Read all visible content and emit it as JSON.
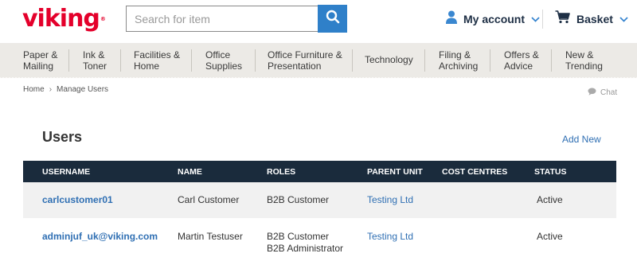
{
  "header": {
    "logo_text": "viking",
    "logo_tm": "®",
    "search_placeholder": "Search for item",
    "search_value": "",
    "account_label": "My account",
    "basket_label": "Basket",
    "brand_color": "#e4002b",
    "accent_color": "#2f80c9"
  },
  "nav": {
    "items": [
      {
        "label": "Paper &\nMailing"
      },
      {
        "label": "Ink &\nToner"
      },
      {
        "label": "Facilities &\nHome"
      },
      {
        "label": "Office\nSupplies"
      },
      {
        "label": "Office Furniture &\nPresentation"
      },
      {
        "label": "Technology"
      },
      {
        "label": "Filing &\nArchiving"
      },
      {
        "label": "Offers &\nAdvice"
      },
      {
        "label": "New &\nTrending"
      }
    ]
  },
  "breadcrumb": {
    "items": [
      "Home",
      "Manage Users"
    ],
    "separator": "›"
  },
  "chat_label": "Chat",
  "main": {
    "title": "Users",
    "add_new_label": "Add New",
    "table": {
      "headers": [
        "USERNAME",
        "NAME",
        "ROLES",
        "PARENT UNIT",
        "COST CENTRES",
        "STATUS"
      ],
      "rows": [
        {
          "username": "carlcustomer01",
          "name": "Carl Customer",
          "roles": [
            "B2B Customer"
          ],
          "parent_unit": "Testing Ltd",
          "cost_centres": "",
          "status": "Active"
        },
        {
          "username": "adminjuf_uk@viking.com",
          "name": "Martin Testuser",
          "roles": [
            "B2B Customer",
            "B2B Administrator"
          ],
          "parent_unit": "Testing Ltd",
          "cost_centres": "",
          "status": "Active"
        }
      ]
    }
  }
}
